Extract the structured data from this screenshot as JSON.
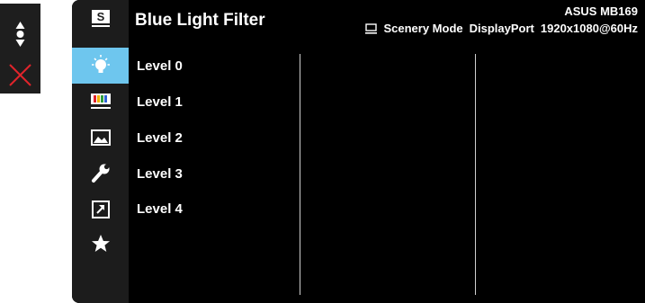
{
  "osd": {
    "title": "Blue Light Filter",
    "model": "ASUS MB169",
    "status": {
      "mode": "Scenery Mode",
      "input": "DisplayPort",
      "resolution": "1920x1080@60Hz"
    }
  },
  "menu": {
    "items": [
      {
        "label": "Level 0"
      },
      {
        "label": "Level 1"
      },
      {
        "label": "Level 2"
      },
      {
        "label": "Level 3"
      },
      {
        "label": "Level 4"
      }
    ]
  },
  "sidebar": {
    "icons": [
      "splendid-icon",
      "blue-light-filter-icon",
      "color-icon",
      "image-icon",
      "system-setup-icon",
      "shortcut-icon",
      "favorite-icon"
    ],
    "active": "blue-light-filter-icon"
  },
  "keys": [
    "navigate-icon",
    "close-icon"
  ],
  "colors": {
    "accent": "#6ec6ee",
    "background": "#000000",
    "sidebar": "#1c1c1c",
    "close": "#e0242b"
  }
}
